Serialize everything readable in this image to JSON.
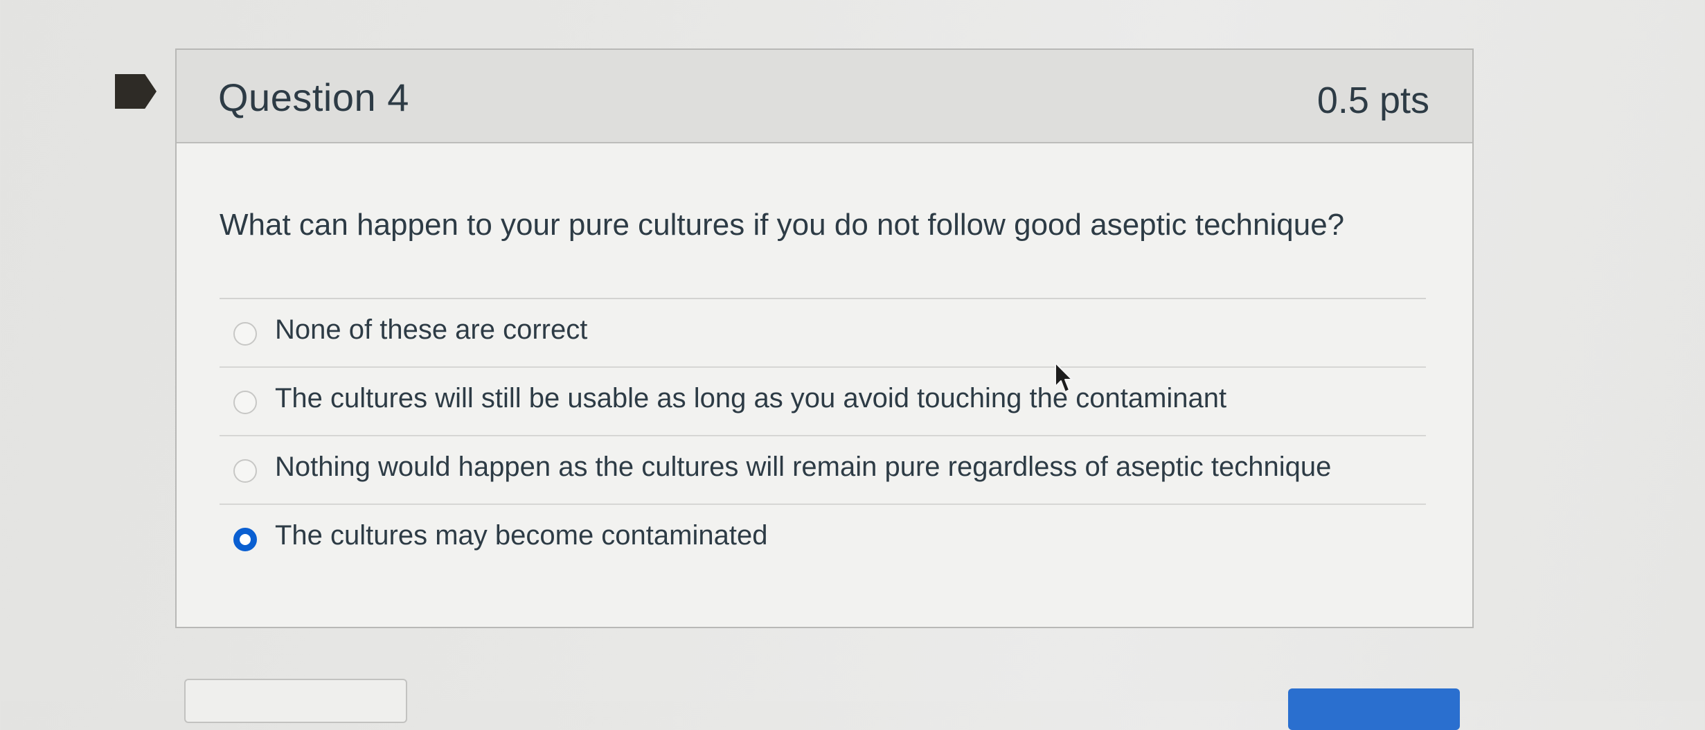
{
  "question": {
    "title": "Question 4",
    "points": "0.5 pts",
    "text": "What can happen to your pure cultures if you do not follow good aseptic technique?",
    "answers": [
      {
        "label": "None of these are correct",
        "selected": false
      },
      {
        "label": "The cultures will still be usable as long as you avoid touching the contaminant",
        "selected": false
      },
      {
        "label": "Nothing would happen as the cultures will remain pure regardless of aseptic technique",
        "selected": false
      },
      {
        "label": "The cultures may become contaminated",
        "selected": true
      }
    ]
  },
  "icons": {
    "flag": "bookmark-flag-icon",
    "cursor": "mouse-pointer-icon"
  },
  "colors": {
    "accent": "#0a5fd1",
    "text": "#2d3b45",
    "header_bg": "#dededc"
  }
}
